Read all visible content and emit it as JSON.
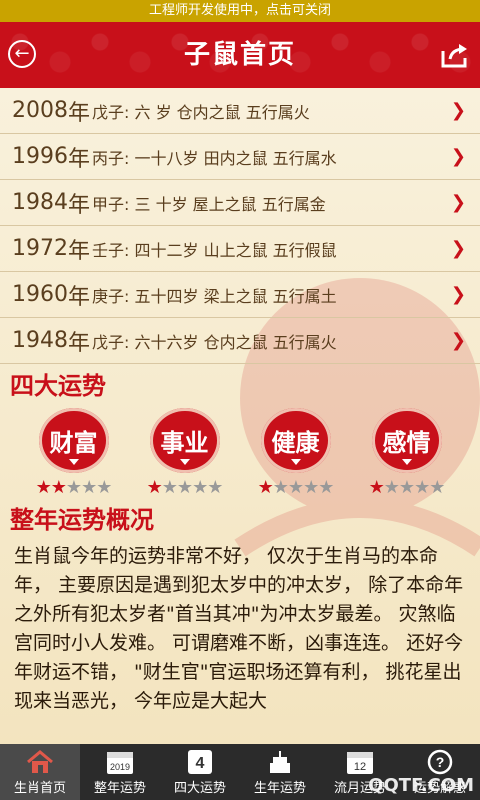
{
  "dev_banner": "工程师开发使用中，点击可关闭",
  "header": {
    "title": "子鼠首页"
  },
  "years": [
    {
      "year": "2008",
      "suffix": "年",
      "desc": "戊子: 六 岁  仓内之鼠  五行属火"
    },
    {
      "year": "1996",
      "suffix": "年",
      "desc": "丙子: 一十八岁  田内之鼠  五行属水"
    },
    {
      "year": "1984",
      "suffix": "年",
      "desc": "甲子: 三 十岁  屋上之鼠  五行属金"
    },
    {
      "year": "1972",
      "suffix": "年",
      "desc": "壬子: 四十二岁  山上之鼠  五行假鼠"
    },
    {
      "year": "1960",
      "suffix": "年",
      "desc": "庚子: 五十四岁  梁上之鼠  五行属土"
    },
    {
      "year": "1948",
      "suffix": "年",
      "desc": "戊子: 六十六岁  仓内之鼠  五行属火"
    }
  ],
  "luck_section_title": "四大运势",
  "luck": [
    {
      "label": "财富",
      "rating": 2,
      "max": 5
    },
    {
      "label": "事业",
      "rating": 1,
      "max": 5
    },
    {
      "label": "健康",
      "rating": 1,
      "max": 5
    },
    {
      "label": "感情",
      "rating": 1,
      "max": 5
    }
  ],
  "overview_title": "整年运势概况",
  "overview_text": "生肖鼠今年的运势非常不好，  仅次于生肖马的本命年，  主要原因是遇到犯太岁中的冲太岁，  除了本命年之外所有犯太岁者\"首当其冲\"为冲太岁最差。  灾煞临宫同时小人发难。  可谓磨难不断，凶事连连。  还好今年财运不错，  \"财生官\"官运职场还算有利，  挑花星出现来当恶光，  今年应是大起大",
  "nav": [
    {
      "label": "生肖首页",
      "icon": "home-icon",
      "active": true
    },
    {
      "label": "整年运势",
      "icon": "calendar-2019-icon",
      "icon_text": "2019"
    },
    {
      "label": "四大运势",
      "icon": "four-icon",
      "icon_text": "4"
    },
    {
      "label": "生年运势",
      "icon": "cake-icon"
    },
    {
      "label": "流月运势",
      "icon": "calendar-12-icon",
      "icon_text": "12"
    },
    {
      "label": "运势解惑",
      "icon": "question-icon",
      "icon_text": "?"
    }
  ],
  "watermark": "QQTF.COM",
  "colors": {
    "accent": "#c8101a",
    "banner": "#c9a300",
    "nav_bg": "#2b2b2b"
  }
}
